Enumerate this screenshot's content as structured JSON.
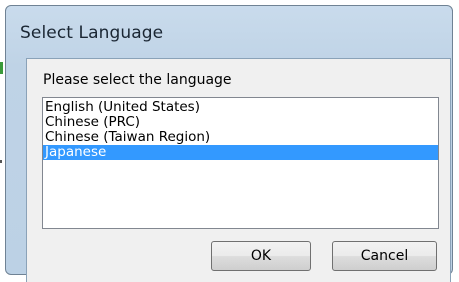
{
  "dialog": {
    "title": "Select Language",
    "prompt": "Please select the language",
    "languages": [
      "English (United States)",
      "Chinese (PRC)",
      "Chinese (Taiwan Region)",
      "Japanese"
    ],
    "selected_language": "Japanese",
    "ok_label": "OK",
    "cancel_label": "Cancel"
  },
  "colors": {
    "selection_background": "#3399ff",
    "selection_text": "#ffffff",
    "title_bar": "#c9dbec"
  }
}
